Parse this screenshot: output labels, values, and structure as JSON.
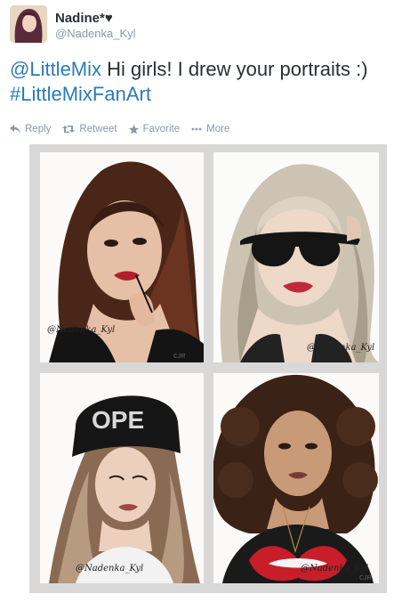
{
  "user": {
    "display_name": "Nadine*♥",
    "handle": "@Nadenka_Kyl"
  },
  "tweet": {
    "mention": "@LittleMix",
    "text": " Hi girls! I drew your portraits :)",
    "hashtag": "#LittleMixFanArt"
  },
  "actions": {
    "reply": "Reply",
    "retweet": "Retweet",
    "favorite": "Favorite",
    "more": "More"
  },
  "photo": {
    "signature": "@Nadenka_Kyl",
    "initials": "CJR"
  },
  "colors": {
    "link": "#2b7bb9",
    "text": "#292f33",
    "muted": "#8899a6",
    "frame": "#d8d8d8"
  }
}
